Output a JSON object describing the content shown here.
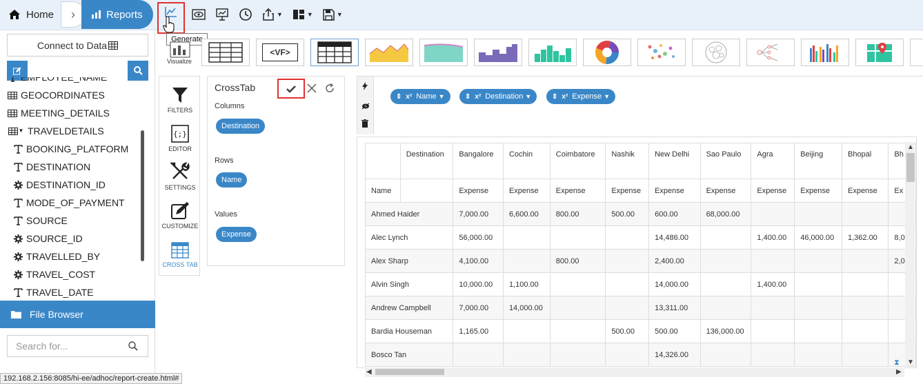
{
  "breadcrumb": {
    "home_label": "Home",
    "reports_label": "Reports"
  },
  "toolbar": {
    "tooltip": "Generate"
  },
  "sidebar": {
    "connect_label": "Connect to Data",
    "tree_items": [
      {
        "label": "EMPLOYEE_NAME",
        "icon": "text"
      },
      {
        "label": "GEOCORDINATES",
        "icon": "table"
      },
      {
        "label": "MEETING_DETAILS",
        "icon": "table"
      },
      {
        "label": "TRAVELDETAILS",
        "icon": "table-open"
      },
      {
        "label": "BOOKING_PLATFORM",
        "icon": "text"
      },
      {
        "label": "DESTINATION",
        "icon": "text"
      },
      {
        "label": "DESTINATION_ID",
        "icon": "gear"
      },
      {
        "label": "MODE_OF_PAYMENT",
        "icon": "text"
      },
      {
        "label": "SOURCE",
        "icon": "text"
      },
      {
        "label": "SOURCE_ID",
        "icon": "gear"
      },
      {
        "label": "TRAVELLED_BY",
        "icon": "gear"
      },
      {
        "label": "TRAVEL_COST",
        "icon": "gear"
      },
      {
        "label": "TRAVEL_DATE",
        "icon": "text"
      }
    ],
    "file_browser_label": "File Browser",
    "search_placeholder": "Search for..."
  },
  "statusbar": {
    "url": "192.168.2.156:8085/hi-ee/adhoc/report-create.html#"
  },
  "visualize": {
    "label": "Visualize",
    "vf_label": "<VF>"
  },
  "toolmenu": [
    {
      "label": "FILTERS"
    },
    {
      "label": "EDITOR"
    },
    {
      "label": "SETTINGS"
    },
    {
      "label": "CUSTOMIZE"
    },
    {
      "label": "CROSS TAB"
    }
  ],
  "crosstab": {
    "title": "CrossTab",
    "columns_label": "Columns",
    "columns_value": "Destination",
    "rows_label": "Rows",
    "rows_value": "Name",
    "values_label": "Values",
    "values_value": "Expense"
  },
  "fields": [
    {
      "prefix": "x²",
      "label": "Name"
    },
    {
      "prefix": "x²",
      "label": "Destination"
    },
    {
      "prefix": "x²",
      "label": "Expense"
    }
  ],
  "table": {
    "corner_label": "Destination",
    "row_header": "Name",
    "columns": [
      "Bangalore",
      "Cochin",
      "Coimbatore",
      "Nashik",
      "New Delhi",
      "Sao Paulo",
      "Agra",
      "Beijing",
      "Bhopal",
      "Bh"
    ],
    "measure": [
      "Expense",
      "Expense",
      "Expense",
      "Expense",
      "Expense",
      "Expense",
      "Expense",
      "Expense",
      "Expense",
      "Ex"
    ],
    "rows": [
      {
        "name": "Ahmed Haider",
        "cells": [
          "7,000.00",
          "6,600.00",
          "800.00",
          "500.00",
          "600.00",
          "68,000.00",
          "",
          "",
          "",
          ""
        ]
      },
      {
        "name": "Alec Lynch",
        "cells": [
          "56,000.00",
          "",
          "",
          "",
          "14,486.00",
          "",
          "1,400.00",
          "46,000.00",
          "1,362.00",
          "8,0"
        ]
      },
      {
        "name": "Alex Sharp",
        "cells": [
          "4,100.00",
          "",
          "800.00",
          "",
          "2,400.00",
          "",
          "",
          "",
          "",
          "2,0"
        ]
      },
      {
        "name": "Alvin Singh",
        "cells": [
          "10,000.00",
          "1,100.00",
          "",
          "",
          "14,000.00",
          "",
          "1,400.00",
          "",
          "",
          ""
        ]
      },
      {
        "name": "Andrew Campbell",
        "cells": [
          "7,000.00",
          "14,000.00",
          "",
          "",
          "13,311.00",
          "",
          "",
          "",
          "",
          ""
        ]
      },
      {
        "name": "Bardia Houseman",
        "cells": [
          "1,165.00",
          "",
          "",
          "500.00",
          "500.00",
          "136,000.00",
          "",
          "",
          "",
          ""
        ]
      },
      {
        "name": "Bosco Tan",
        "cells": [
          "",
          "",
          "",
          "",
          "14,326.00",
          "",
          "",
          "",
          "",
          ""
        ]
      }
    ]
  },
  "colors": {
    "accent": "#3a87c8",
    "highlight": "#e03030"
  }
}
